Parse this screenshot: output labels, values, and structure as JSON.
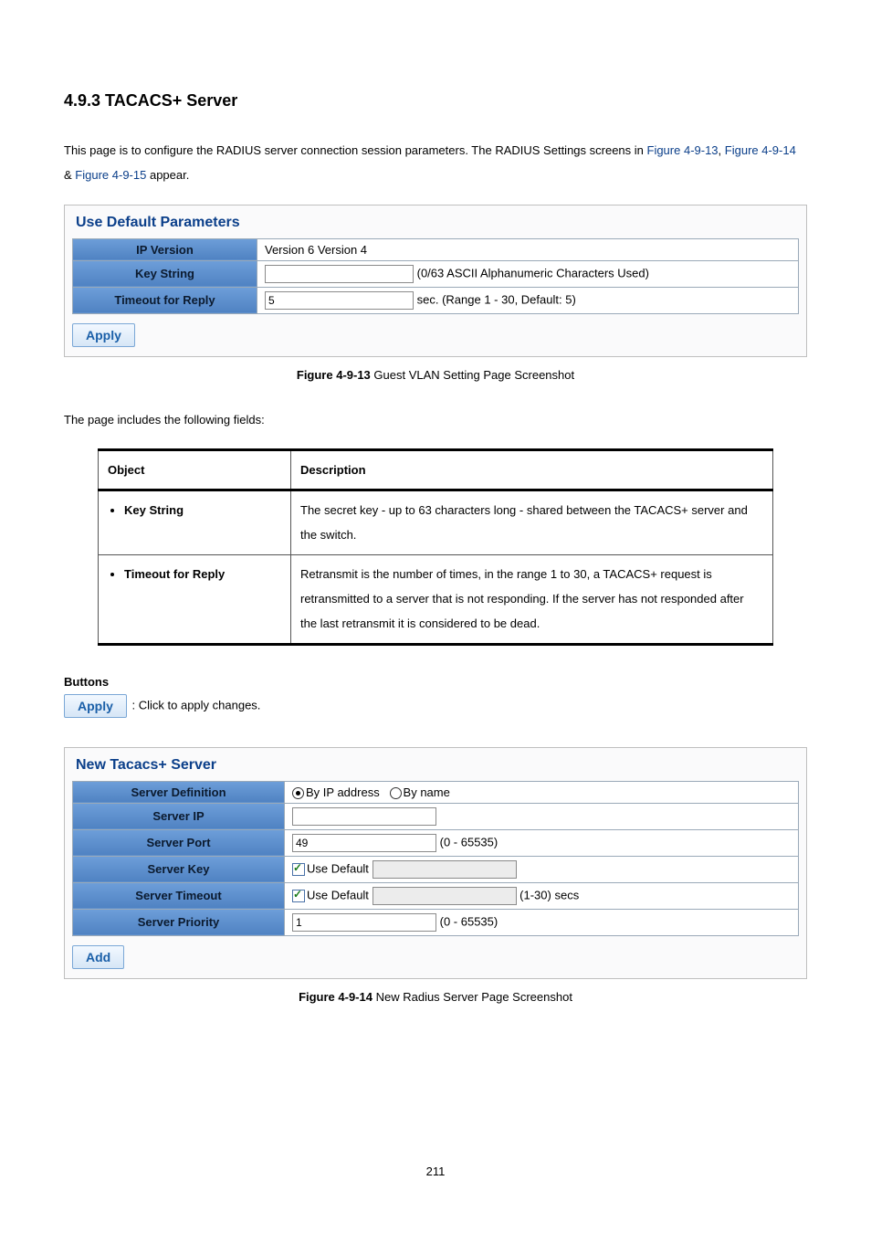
{
  "section_title": "4.9.3 TACACS+ Server",
  "intro": {
    "text1": "This page is to configure the RADIUS server connection session parameters. The RADIUS Settings screens in ",
    "link1": "Figure 4-9-13",
    "text2": ", ",
    "link2": "Figure 4-9-14",
    "text3": " & ",
    "link3": "Figure 4-9-15",
    "text4": " appear."
  },
  "panel1": {
    "title": "Use Default Parameters",
    "rows": {
      "ip_version": {
        "label": "IP Version",
        "value": "Version 6 Version 4"
      },
      "key_string": {
        "label": "Key String",
        "value": "",
        "hint": "(0/63 ASCII Alphanumeric Characters Used)"
      },
      "timeout": {
        "label": "Timeout for Reply",
        "value": "5",
        "hint": "sec. (Range 1 - 30, Default: 5)"
      }
    },
    "apply_label": "Apply"
  },
  "fig1": {
    "bold": "Figure 4-9-13",
    "rest": " Guest VLAN Setting Page Screenshot"
  },
  "fields_intro": "The page includes the following fields:",
  "table": {
    "hdr_object": "Object",
    "hdr_desc": "Description",
    "rows": [
      {
        "object": "Key String",
        "desc": "The secret key - up to 63 characters long - shared between the TACACS+ server and the switch."
      },
      {
        "object": "Timeout for Reply",
        "desc": "Retransmit is the number of times, in the range 1 to 30, a TACACS+ request is retransmitted to a server that is not responding. If the server has not responded after the last retransmit it is considered to be dead."
      }
    ]
  },
  "buttons": {
    "heading": "Buttons",
    "apply_label": "Apply",
    "apply_desc": ": Click to apply changes."
  },
  "panel2": {
    "title": "New Tacacs+ Server",
    "rows": {
      "definition": {
        "label": "Server Definition",
        "opt_ip": "By IP address",
        "opt_name": "By name"
      },
      "ip": {
        "label": "Server IP",
        "value": ""
      },
      "port": {
        "label": "Server Port",
        "value": "49",
        "hint": "(0 - 65535)"
      },
      "key": {
        "label": "Server Key",
        "chk": "Use Default",
        "value": ""
      },
      "timeout": {
        "label": "Server Timeout",
        "chk": "Use Default",
        "value": "",
        "hint": "(1-30) secs"
      },
      "priority": {
        "label": "Server Priority",
        "value": "1",
        "hint": "(0 - 65535)"
      }
    },
    "add_label": "Add"
  },
  "fig2": {
    "bold": "Figure 4-9-14",
    "rest": " New Radius Server Page Screenshot"
  },
  "page_number": "211"
}
